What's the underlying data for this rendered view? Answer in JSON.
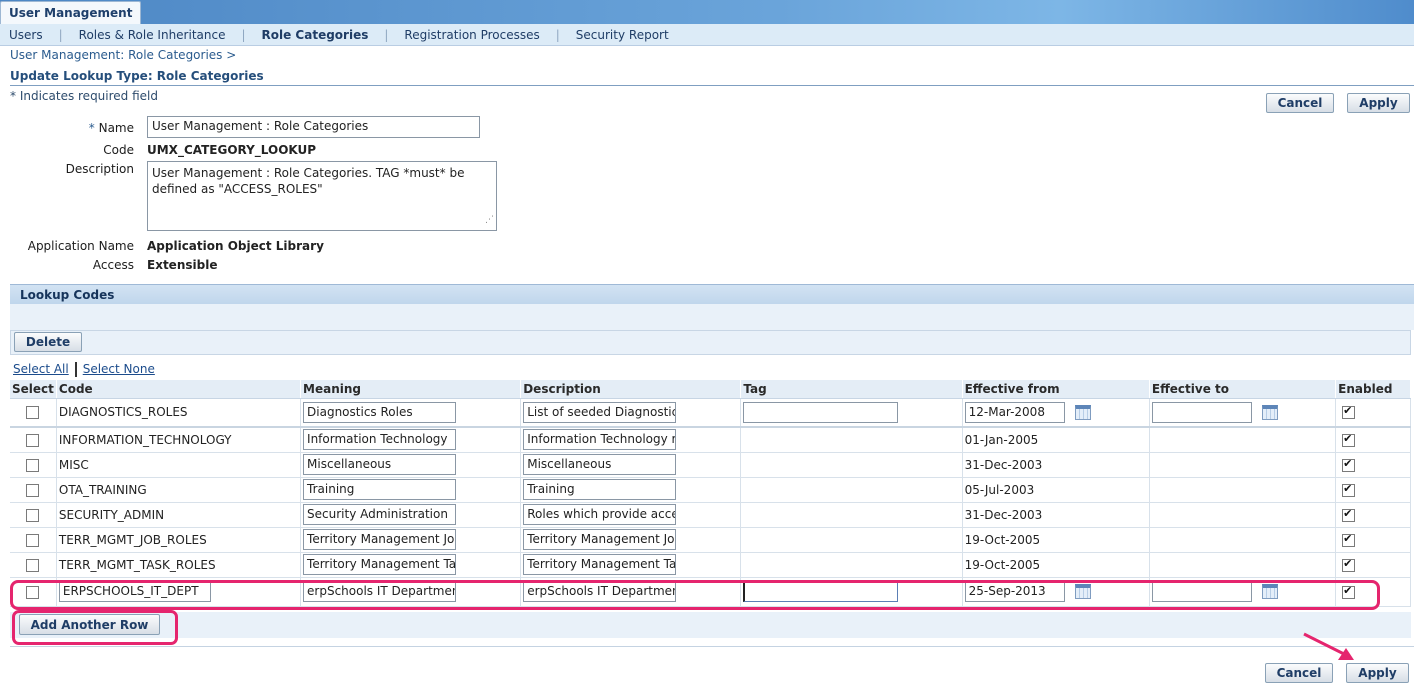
{
  "app": {
    "title": "User Management"
  },
  "nav": {
    "items": [
      {
        "label": "Users",
        "active": false
      },
      {
        "label": "Roles & Role Inheritance",
        "active": false
      },
      {
        "label": "Role Categories",
        "active": true
      },
      {
        "label": "Registration Processes",
        "active": false
      },
      {
        "label": "Security Report",
        "active": false
      }
    ],
    "separator": "|"
  },
  "breadcrumb": "User Management: Role Categories  >",
  "page_title": "Update Lookup Type: Role Categories",
  "required_note": "*  Indicates required field",
  "buttons": {
    "cancel": "Cancel",
    "apply": "Apply",
    "delete": "Delete",
    "add_row": "Add Another Row"
  },
  "form": {
    "name_star": "*",
    "name_label": "Name",
    "name_value": "User Management : Role Categories",
    "code_label": "Code",
    "code_value": "UMX_CATEGORY_LOOKUP",
    "description_label": "Description",
    "description_value": "User Management : Role Categories. TAG *must* be defined as \"ACCESS_ROLES\"",
    "app_name_label": "Application Name",
    "app_name_value": "Application Object Library",
    "access_label": "Access",
    "access_value": "Extensible"
  },
  "lookup": {
    "section_title": "Lookup Codes",
    "select_all": "Select All",
    "select_none": "Select None",
    "columns": [
      "Select",
      "Code",
      "Meaning",
      "Description",
      "Tag",
      "Effective from",
      "Effective to",
      "Enabled"
    ],
    "rows": [
      {
        "code": "DIAGNOSTICS_ROLES",
        "meaning": "Diagnostics Roles",
        "description": "List of seeded Diagnostics",
        "tag": "",
        "effective_from": "12-Mar-2008",
        "effective_to": "",
        "enabled": true
      },
      {
        "code": "INFORMATION_TECHNOLOGY",
        "meaning": "Information Technology",
        "description": "Information Technology re",
        "tag": "",
        "effective_from": "01-Jan-2005",
        "effective_to": "",
        "enabled": true
      },
      {
        "code": "MISC",
        "meaning": "Miscellaneous",
        "description": "Miscellaneous",
        "tag": "",
        "effective_from": "31-Dec-2003",
        "effective_to": "",
        "enabled": true
      },
      {
        "code": "OTA_TRAINING",
        "meaning": "Training",
        "description": "Training",
        "tag": "",
        "effective_from": "05-Jul-2003",
        "effective_to": "",
        "enabled": true
      },
      {
        "code": "SECURITY_ADMIN",
        "meaning": "Security Administration",
        "description": "Roles which provide acces",
        "tag": "",
        "effective_from": "31-Dec-2003",
        "effective_to": "",
        "enabled": true
      },
      {
        "code": "TERR_MGMT_JOB_ROLES",
        "meaning": "Territory Management Jol",
        "description": "Territory Management Jol",
        "tag": "",
        "effective_from": "19-Oct-2005",
        "effective_to": "",
        "enabled": true
      },
      {
        "code": "TERR_MGMT_TASK_ROLES",
        "meaning": "Territory Management Ta",
        "description": "Territory Management Ta",
        "tag": "",
        "effective_from": "19-Oct-2005",
        "effective_to": "",
        "enabled": true
      },
      {
        "code": "ERPSCHOOLS_IT_DEPT",
        "meaning": "erpSchools IT Departmen",
        "description": "erpSchools IT Department",
        "tag": "",
        "effective_from": "25-Sep-2013",
        "effective_to": "",
        "enabled": true
      }
    ]
  },
  "colors": {
    "highlight": "#e5256e",
    "header_blue": "#4c86c4",
    "link": "#1c4c8c"
  }
}
